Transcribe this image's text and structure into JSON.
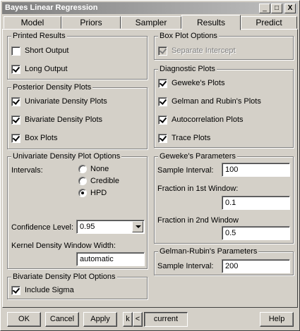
{
  "window": {
    "title": "Bayes Linear Regression",
    "minimize": "_",
    "maximize": "□",
    "close": "X"
  },
  "tabs": [
    {
      "label": "Model",
      "active": false
    },
    {
      "label": "Priors",
      "active": false
    },
    {
      "label": "Sampler",
      "active": false
    },
    {
      "label": "Results",
      "active": true
    },
    {
      "label": "Predict",
      "active": false
    }
  ],
  "printed_results": {
    "title": "Printed Results",
    "short_output": {
      "label": "Short Output",
      "checked": false
    },
    "long_output": {
      "label": "Long Output",
      "checked": true
    }
  },
  "posterior_density": {
    "title": "Posterior Density Plots",
    "univariate": {
      "label": "Univariate Density Plots",
      "checked": true
    },
    "bivariate": {
      "label": "Bivariate Density Plots",
      "checked": true
    },
    "box": {
      "label": "Box Plots",
      "checked": true
    }
  },
  "univariate_options": {
    "title": "Univariate Density Plot Options",
    "intervals_label": "Intervals:",
    "radio_none": "None",
    "radio_credible": "Credible",
    "radio_hpd": "HPD",
    "selected": "HPD",
    "confidence_label": "Confidence Level:",
    "confidence_value": "0.95",
    "kernel_label": "Kernel Density Window Width:",
    "kernel_value": "automatic"
  },
  "bivariate_options": {
    "title": "Bivariate Density Plot Options",
    "include_sigma": {
      "label": "Include Sigma",
      "checked": true
    }
  },
  "box_plot_options": {
    "title": "Box Plot Options",
    "separate_intercept": {
      "label": "Separate Intercept",
      "checked": true,
      "disabled": true
    }
  },
  "diagnostic_plots": {
    "title": "Diagnostic Plots",
    "geweke": {
      "label": "Geweke's Plots",
      "checked": true
    },
    "gelman": {
      "label": "Gelman and Rubin's Plots",
      "checked": true
    },
    "autocorr": {
      "label": "Autocorrelation Plots",
      "checked": true
    },
    "trace": {
      "label": "Trace Plots",
      "checked": true
    }
  },
  "geweke_params": {
    "title": "Geweke's Parameters",
    "sample_interval_label": "Sample Interval:",
    "sample_interval_value": "100",
    "fraction1_label": "Fraction in 1st Window:",
    "fraction1_value": "0.1",
    "fraction2_label": "Fraction in 2nd Window",
    "fraction2_value": "0.5"
  },
  "gelman_params": {
    "title": "Gelman-Rubin's Parameters",
    "sample_interval_label": "Sample Interval:",
    "sample_interval_value": "200"
  },
  "buttons": {
    "ok": "OK",
    "cancel": "Cancel",
    "apply": "Apply",
    "prev": "k",
    "next": "<",
    "current": "current",
    "help": "Help"
  }
}
